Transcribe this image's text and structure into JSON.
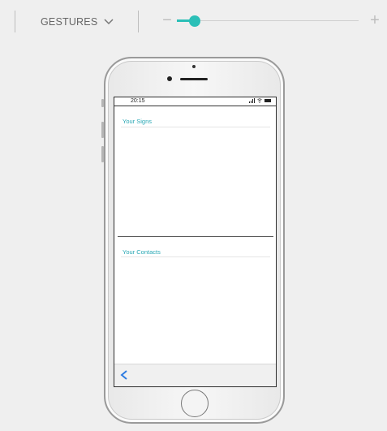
{
  "toolbar": {
    "gestures_label": "GESTURES",
    "zoom_level": 0.1
  },
  "device": {
    "status_time": "20:15",
    "sections": [
      {
        "title": "Your Signs"
      },
      {
        "title": "Your Contacts"
      }
    ]
  },
  "colors": {
    "accent": "#2bbfb7",
    "section_title": "#2aa8b5",
    "back_arrow": "#2f7de1"
  },
  "icons": [
    "chevron-down-icon",
    "zoom-out-icon",
    "zoom-in-icon",
    "signal-icon",
    "wifi-icon",
    "battery-icon",
    "back-arrow-icon"
  ]
}
